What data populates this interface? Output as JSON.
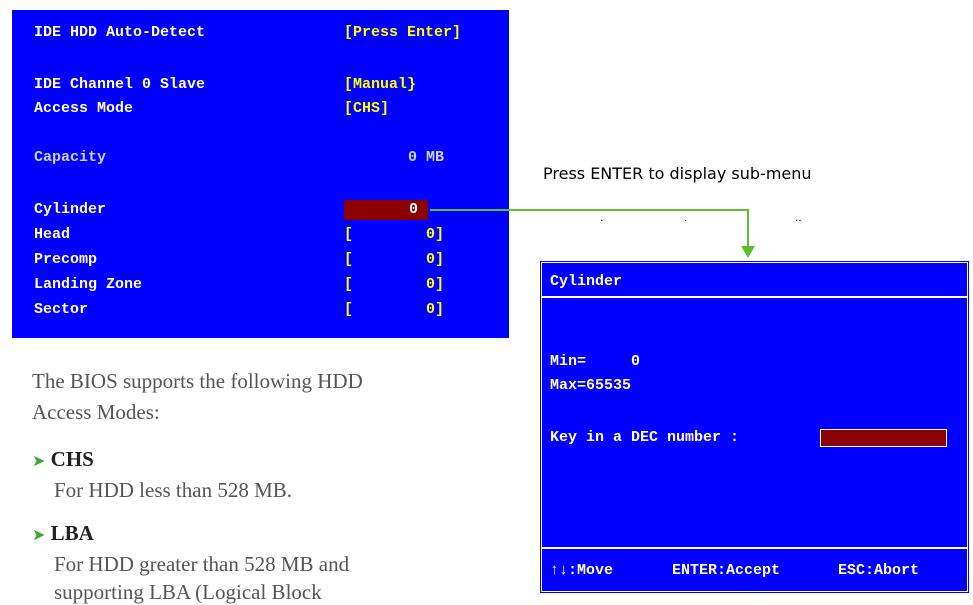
{
  "bios_panel": {
    "auto_detect": {
      "label": "IDE HDD Auto-Detect",
      "value": "[Press Enter]"
    },
    "channel": {
      "label": "IDE Channel 0 Slave",
      "value": "[Manual}"
    },
    "access_mode": {
      "label": "Access Mode",
      "value": "[CHS]"
    },
    "capacity": {
      "label": "Capacity",
      "value": "0 MB"
    },
    "cylinder": {
      "label": "Cylinder",
      "value": "0"
    },
    "head": {
      "label": "Head",
      "bracket": "[",
      "value": "0]"
    },
    "precomp": {
      "label": "Precomp",
      "bracket": "[",
      "value": "0]"
    },
    "landing_zone": {
      "label": "Landing Zone",
      "bracket": "[",
      "value": "0]"
    },
    "sector": {
      "label": "Sector",
      "bracket": "[",
      "value": "0]"
    }
  },
  "callout": {
    "text": "Press ENTER to display sub-menu",
    "dots": [
      ".",
      ".",
      ".."
    ]
  },
  "popup": {
    "title": "Cylinder",
    "min_line": "Min=     0",
    "max_line": "Max=65535",
    "prompt": "Key in a DEC number :",
    "footer": {
      "move": "↑↓:Move",
      "accept": "ENTER:Accept",
      "abort": "ESC:Abort"
    }
  },
  "document": {
    "intro_line1": "The BIOS supports the following HDD",
    "intro_line2": "Access Modes:",
    "modes": [
      {
        "name": "CHS",
        "desc": "For HDD less than 528 MB."
      },
      {
        "name": "LBA",
        "desc": "For HDD greater than 528 MB and",
        "desc2": "supporting LBA (Logical Block"
      }
    ]
  },
  "colors": {
    "bios_bg": "#0000ff",
    "value_yellow": "#ffff00",
    "selection_red": "#8b0000",
    "arrow_green": "#5cc030"
  }
}
